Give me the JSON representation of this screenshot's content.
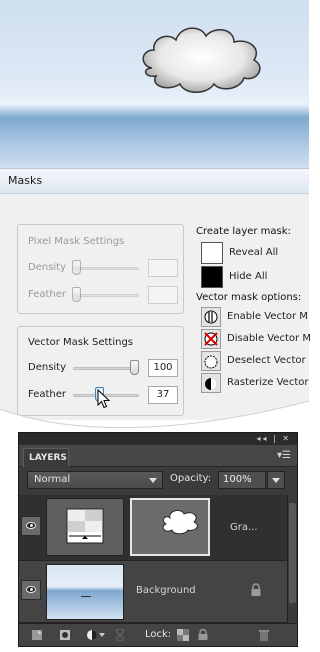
{
  "masks_panel": {
    "title": "Masks",
    "pixel_mask": {
      "heading": "Pixel Mask Settings",
      "density_label": "Density",
      "feather_label": "Feather"
    },
    "vector_mask": {
      "heading": "Vector Mask Settings",
      "density_label": "Density",
      "density_value": "100",
      "feather_label": "Feather",
      "feather_value": "37"
    },
    "create_layer_mask": {
      "heading": "Create layer mask:",
      "reveal_all": "Reveal All",
      "hide_all": "Hide All"
    },
    "vector_mask_options": {
      "heading": "Vector mask options:",
      "items": [
        "Enable Vector M",
        "Disable Vector M",
        "Deselect Vector",
        "Rasterize Vector"
      ]
    }
  },
  "layers_panel": {
    "tab_label": "LAYERS",
    "blend_mode": "Normal",
    "opacity_label": "Opacity:",
    "opacity_value": "100%",
    "layers": [
      {
        "name": "Gra...",
        "visible": true,
        "selected": true
      },
      {
        "name": "Background",
        "visible": true,
        "selected": false,
        "locked": true
      }
    ],
    "lock_label": "Lock:"
  },
  "colors": {
    "layers_bg": "#3b3b3b",
    "dialog_bg": "#f0f0f0",
    "selection_accent": "#3c7fb1"
  }
}
